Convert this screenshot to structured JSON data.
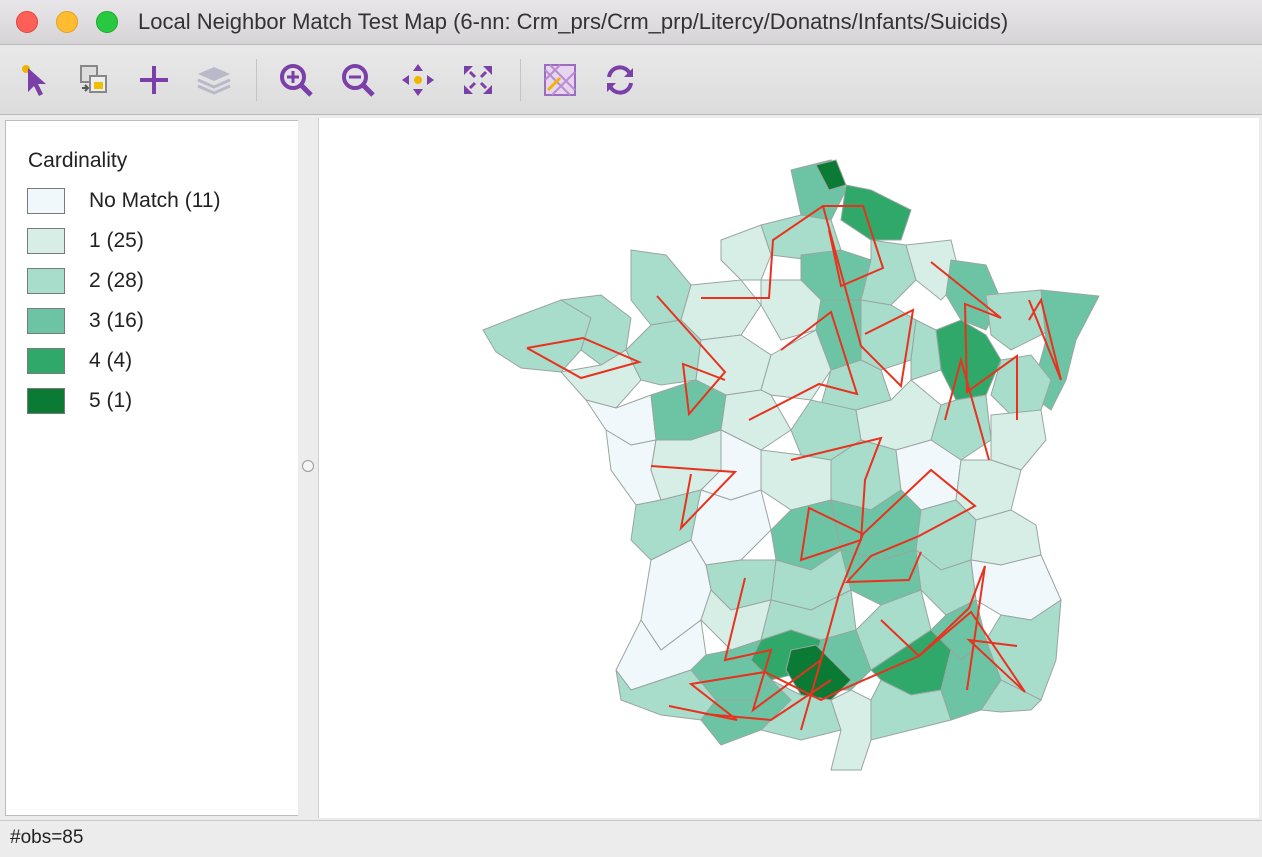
{
  "window": {
    "title": "Local Neighbor Match Test Map (6-nn: Crm_prs/Crm_prp/Litercy/Donatns/Infants/Suicids)"
  },
  "toolbar": {
    "buttons": [
      "select-tool-icon",
      "copy-image-icon",
      "add-layer-icon",
      "layers-icon",
      "zoom-in-icon",
      "zoom-out-icon",
      "pan-icon",
      "full-extent-icon",
      "map-basemap-icon",
      "refresh-icon"
    ],
    "accent_color": "#7b3fa8"
  },
  "legend": {
    "title": "Cardinality",
    "items": [
      {
        "label": "No Match (11)",
        "color": "#f0f8fb"
      },
      {
        "label": "1 (25)",
        "color": "#d6eee6"
      },
      {
        "label": "2 (28)",
        "color": "#a8dccb"
      },
      {
        "label": "3 (16)",
        "color": "#6cc4a4"
      },
      {
        "label": "4 (4)",
        "color": "#2fa86a"
      },
      {
        "label": "5 (1)",
        "color": "#0b7a35"
      }
    ]
  },
  "map": {
    "link_color": "#e8321e",
    "border_color": "#9aa5a0"
  },
  "status": {
    "text": "#obs=85"
  }
}
